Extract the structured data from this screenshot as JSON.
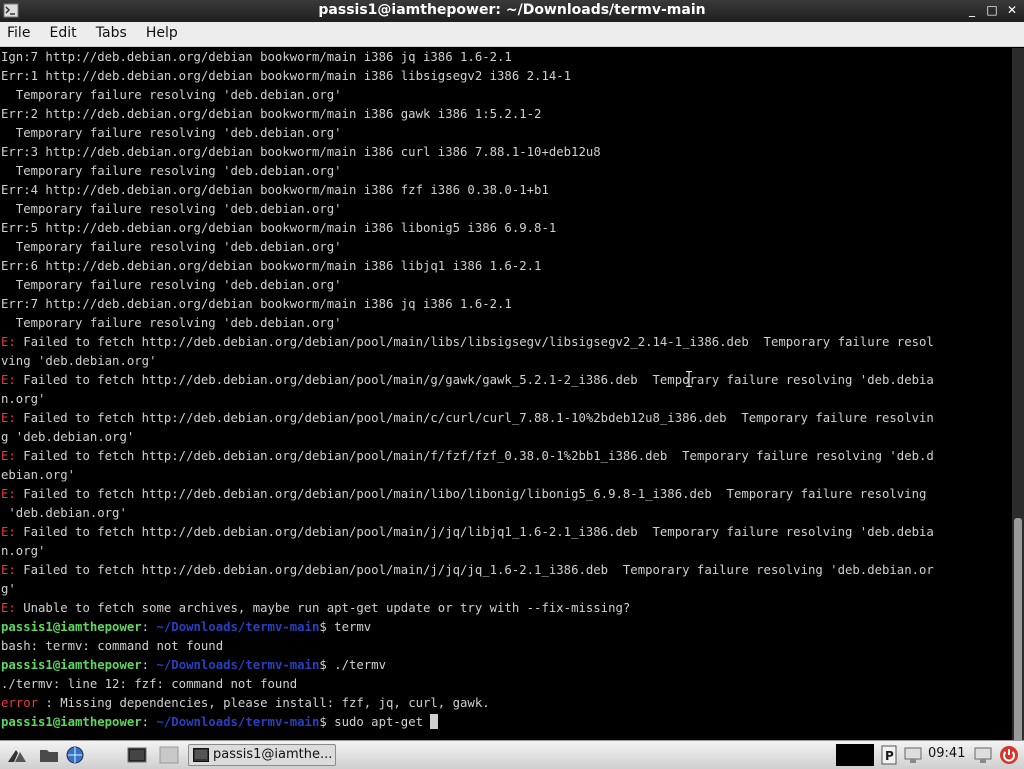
{
  "window": {
    "title": "passis1@iamthepower: ~/Downloads/termv-main",
    "minimize": "_",
    "maximize": "□",
    "close": "✕"
  },
  "menu": [
    "File",
    "Edit",
    "Tabs",
    "Help"
  ],
  "colors": {
    "error_red": "#e8383d",
    "prompt_green": "#5fd75f",
    "path_blue": "#2a3fbf"
  },
  "terminal": {
    "lines": [
      [
        {
          "t": "Ign:7 http://deb.debian.org/debian bookworm/main i386 jq i386 1.6-2.1"
        }
      ],
      [
        {
          "t": "Err:1 http://deb.debian.org/debian bookworm/main i386 libsigsegv2 i386 2.14-1"
        }
      ],
      [
        {
          "t": "  Temporary failure resolving 'deb.debian.org'"
        }
      ],
      [
        {
          "t": "Err:2 http://deb.debian.org/debian bookworm/main i386 gawk i386 1:5.2.1-2"
        }
      ],
      [
        {
          "t": "  Temporary failure resolving 'deb.debian.org'"
        }
      ],
      [
        {
          "t": "Err:3 http://deb.debian.org/debian bookworm/main i386 curl i386 7.88.1-10+deb12u8"
        }
      ],
      [
        {
          "t": "  Temporary failure resolving 'deb.debian.org'"
        }
      ],
      [
        {
          "t": "Err:4 http://deb.debian.org/debian bookworm/main i386 fzf i386 0.38.0-1+b1"
        }
      ],
      [
        {
          "t": "  Temporary failure resolving 'deb.debian.org'"
        }
      ],
      [
        {
          "t": "Err:5 http://deb.debian.org/debian bookworm/main i386 libonig5 i386 6.9.8-1"
        }
      ],
      [
        {
          "t": "  Temporary failure resolving 'deb.debian.org'"
        }
      ],
      [
        {
          "t": "Err:6 http://deb.debian.org/debian bookworm/main i386 libjq1 i386 1.6-2.1"
        }
      ],
      [
        {
          "t": "  Temporary failure resolving 'deb.debian.org'"
        }
      ],
      [
        {
          "t": "Err:7 http://deb.debian.org/debian bookworm/main i386 jq i386 1.6-2.1"
        }
      ],
      [
        {
          "t": "  Temporary failure resolving 'deb.debian.org'"
        }
      ],
      [
        {
          "t": "E:",
          "c": "red"
        },
        {
          "t": " Failed to fetch http://deb.debian.org/debian/pool/main/libs/libsigsegv/libsigsegv2_2.14-1_i386.deb  Temporary failure resol"
        }
      ],
      [
        {
          "t": "ving 'deb.debian.org'"
        }
      ],
      [
        {
          "t": "E:",
          "c": "red"
        },
        {
          "t": " Failed to fetch http://deb.debian.org/debian/pool/main/g/gawk/gawk_5.2.1-2_i386.deb  Temporary failure resolving 'deb.debia"
        }
      ],
      [
        {
          "t": "n.org'"
        }
      ],
      [
        {
          "t": "E:",
          "c": "red"
        },
        {
          "t": " Failed to fetch http://deb.debian.org/debian/pool/main/c/curl/curl_7.88.1-10%2bdeb12u8_i386.deb  Temporary failure resolvin"
        }
      ],
      [
        {
          "t": "g 'deb.debian.org'"
        }
      ],
      [
        {
          "t": "E:",
          "c": "red"
        },
        {
          "t": " Failed to fetch http://deb.debian.org/debian/pool/main/f/fzf/fzf_0.38.0-1%2bb1_i386.deb  Temporary failure resolving 'deb.d"
        }
      ],
      [
        {
          "t": "ebian.org'"
        }
      ],
      [
        {
          "t": "E:",
          "c": "red"
        },
        {
          "t": " Failed to fetch http://deb.debian.org/debian/pool/main/libo/libonig/libonig5_6.9.8-1_i386.deb  Temporary failure resolving"
        }
      ],
      [
        {
          "t": " 'deb.debian.org'"
        }
      ],
      [
        {
          "t": "E:",
          "c": "red"
        },
        {
          "t": " Failed to fetch http://deb.debian.org/debian/pool/main/j/jq/libjq1_1.6-2.1_i386.deb  Temporary failure resolving 'deb.debia"
        }
      ],
      [
        {
          "t": "n.org'"
        }
      ],
      [
        {
          "t": "E:",
          "c": "red"
        },
        {
          "t": " Failed to fetch http://deb.debian.org/debian/pool/main/j/jq/jq_1.6-2.1_i386.deb  Temporary failure resolving 'deb.debian.or"
        }
      ],
      [
        {
          "t": "g'"
        }
      ],
      [
        {
          "t": "E:",
          "c": "red"
        },
        {
          "t": " Unable to fetch some archives, maybe run apt-get update or try with --fix-missing?"
        }
      ],
      [
        {
          "t": "passis1@iamthepower",
          "c": "green"
        },
        {
          "t": ": "
        },
        {
          "t": "~/Downloads/termv-main",
          "c": "blue"
        },
        {
          "t": "$ termv"
        }
      ],
      [
        {
          "t": "bash: termv: command not found"
        }
      ],
      [
        {
          "t": "passis1@iamthepower",
          "c": "green"
        },
        {
          "t": ": "
        },
        {
          "t": "~/Downloads/termv-main",
          "c": "blue"
        },
        {
          "t": "$ ./termv"
        }
      ],
      [
        {
          "t": "./termv: line 12: fzf: command not found"
        }
      ],
      [
        {
          "t": "error",
          "c": "red"
        },
        {
          "t": " : Missing dependencies, please install: fzf, jq, curl, gawk."
        }
      ],
      [
        {
          "t": "passis1@iamthepower",
          "c": "green"
        },
        {
          "t": ": "
        },
        {
          "t": "~/Downloads/termv-main",
          "c": "blue"
        },
        {
          "t": "$ sudo apt-get "
        }
      ]
    ]
  },
  "taskbar": {
    "start_icon": "start-menu-icon",
    "launchers": [
      "file-manager-icon",
      "web-browser-icon",
      "terminal-icon",
      "blank-window-icon"
    ],
    "task_label": "passis1@iamthe...",
    "tray_icons": [
      "pager-icon",
      "network-icon",
      "volume-icon",
      "shutdown-icon"
    ],
    "clock": "09:41"
  }
}
